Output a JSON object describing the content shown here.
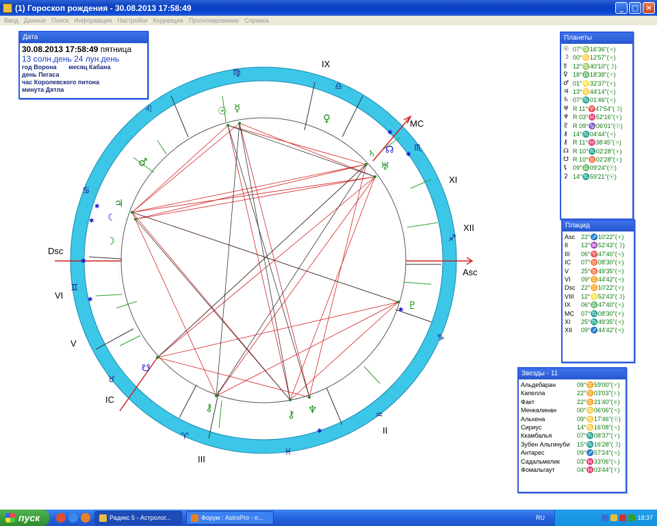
{
  "window": {
    "title": "(1) Гороскоп рождения  -  30.08.2013  17:58:49",
    "buttons": {
      "minimize": "_",
      "maximize": "□",
      "close": "×"
    }
  },
  "menu": [
    "Ввод",
    "Данные",
    "Поиск",
    "Информация",
    "Настройки",
    "Коррекция",
    "Прогнозирование",
    "Справка"
  ],
  "date_panel": {
    "header": "Дата",
    "datetime": "30.08.2013  17:58:49",
    "weekday": "пятница",
    "days": "13 солн.день 24 лун.день",
    "year": "год Ворона",
    "month": "месяц Кабана",
    "day": "день Пегаса",
    "hour": "час Королевского питона",
    "minute": "минута Дятла"
  },
  "planets_panel": {
    "header": "Планеты",
    "rows": [
      {
        "sym": "☉",
        "val": "07°♍16'36\"(♃)"
      },
      {
        "sym": "☽",
        "val": "00°♋12'57\"(♃)"
      },
      {
        "sym": "☿",
        "val": "12°♍40'10\"(☽)"
      },
      {
        "sym": "♀",
        "val": "18°♎18'38\"(♂)"
      },
      {
        "sym": "♂",
        "val": "01°♌32'37\"(♆)"
      },
      {
        "sym": "♃",
        "val": "13°♋44'14\"(♃)"
      },
      {
        "sym": "♄",
        "val": "07°♏01'46\"(♃)"
      },
      {
        "sym": "♅",
        "val": "R 11°♈47'54\"(☽)"
      },
      {
        "sym": "♆",
        "val": "R 03°♓52'16\"(☿)"
      },
      {
        "sym": "♇",
        "val": "R 09°♑06'01\"(☉)"
      },
      {
        "sym": "⚷",
        "val": "14°♏04'44\"(♃)"
      },
      {
        "sym": "⚷",
        "val": "R 11°♓38'45\"(♃)"
      },
      {
        "sym": "☊",
        "val": "R 10°♏02'28\"(♆)"
      },
      {
        "sym": "☋",
        "val": "R 10°♉02'28\"(♀)"
      },
      {
        "sym": "⚸",
        "val": "09°♎09'24\"(☉)"
      },
      {
        "sym": "⚳",
        "val": "14°♏59'21\"(☉)"
      }
    ]
  },
  "houses_panel": {
    "header": "Плацид",
    "rows": [
      {
        "lbl": "Asc",
        "val": "22°♐10'22\"(♆)"
      },
      {
        "lbl": "II",
        "val": "12°♒52'43\"(☽)"
      },
      {
        "lbl": "III",
        "val": "06°♈47'40\"(♃)"
      },
      {
        "lbl": "IC",
        "val": "07°♉08'30\"(♆)"
      },
      {
        "lbl": "V",
        "val": "25°♉49'35\"(♃)"
      },
      {
        "lbl": "VI",
        "val": "09°♊44'42\"(♃)"
      },
      {
        "lbl": "Dsc",
        "val": "22°♊10'22\"(♆)"
      },
      {
        "lbl": "VIII",
        "val": "12°♌52'43\"(☽)"
      },
      {
        "lbl": "IX",
        "val": "06°♎47'40\"(♃)"
      },
      {
        "lbl": "MC",
        "val": "07°♏08'30\"(♆)"
      },
      {
        "lbl": "XI",
        "val": "25°♏49'35\"(♃)"
      },
      {
        "lbl": "XII",
        "val": "09°♐44'42\"(♃)"
      }
    ]
  },
  "stars_panel": {
    "header": "Звезды - 11",
    "rows": [
      {
        "lbl": "Альдебаран",
        "val": "09°♊59'00\"(♂)"
      },
      {
        "lbl": "Капелла",
        "val": "22°♊03'03\"(♄)"
      },
      {
        "lbl": "Факт",
        "val": "22°♊21'40\"(♅)"
      },
      {
        "lbl": "Менкалинан",
        "val": "00°♋06'06\"(♃)"
      },
      {
        "lbl": "Альхена",
        "val": "09°♋17'46\"(☉)"
      },
      {
        "lbl": "Сириус",
        "val": "14°♋16'08\"(♃)"
      },
      {
        "lbl": "Ккамбалья",
        "val": "07°♏08'37\"(♆)"
      },
      {
        "lbl": "Зубен Альгинуби",
        "val": "15°♏16'28\"(☽)"
      },
      {
        "lbl": "Антарес",
        "val": "09°♐57'24\"(♃)"
      },
      {
        "lbl": "Садальмелик",
        "val": "03°♓33'06\"(♄)"
      },
      {
        "lbl": "Фомальгаут",
        "val": "04°♓03'44\"(☿)"
      }
    ]
  },
  "chart_labels": {
    "asc": "Asc",
    "dsc": "Dsc",
    "mc": "MC",
    "ic": "IC",
    "houses": {
      "ii": "II",
      "iii": "III",
      "v": "V",
      "vi": "VI",
      "ix": "IX",
      "xi": "XI",
      "xii": "XII"
    },
    "zodiac": [
      "♍",
      "♎",
      "♏",
      "♐",
      "♑",
      "♒",
      "♓",
      "♈",
      "♉",
      "♊",
      "♋",
      "♌"
    ]
  },
  "colors": {
    "ring": "#3cc6e8",
    "aspect_red": "#d42020",
    "aspect_black": "#202020",
    "planet_green": "#1a8a1a",
    "star_blue": "#1a1acc",
    "axis_red": "#cc2020"
  },
  "taskbar": {
    "start": "пуск",
    "tasks": [
      "Радикс 5 - Астролог...",
      "Форум : AstroPro - п..."
    ],
    "lang": "RU",
    "time": "18:37"
  }
}
